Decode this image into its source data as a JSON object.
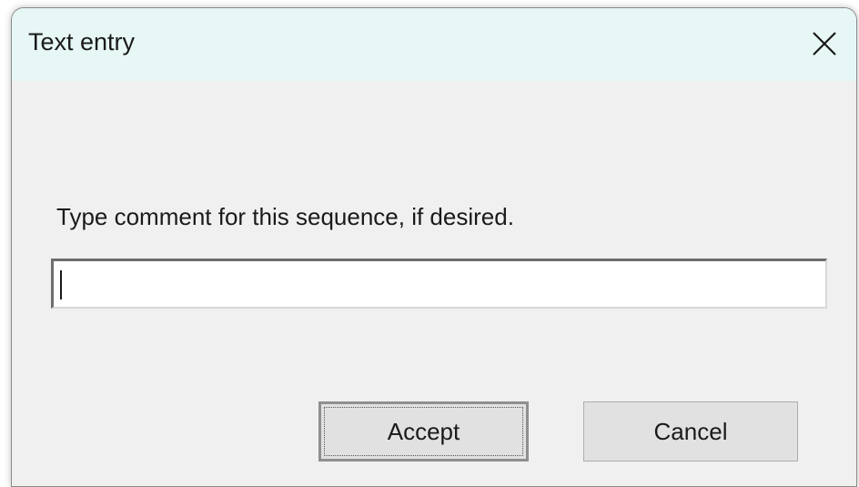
{
  "dialog": {
    "title": "Text entry",
    "prompt": "Type comment for this sequence, if desired.",
    "input": {
      "value": "",
      "placeholder": ""
    },
    "accept_label": "Accept",
    "cancel_label": "Cancel"
  },
  "icons": {
    "close": "close-icon"
  },
  "colors": {
    "title_bar": "#e6f7f6",
    "dialog_bg": "#f0f0f0",
    "button_bg": "#e1e1e1"
  }
}
